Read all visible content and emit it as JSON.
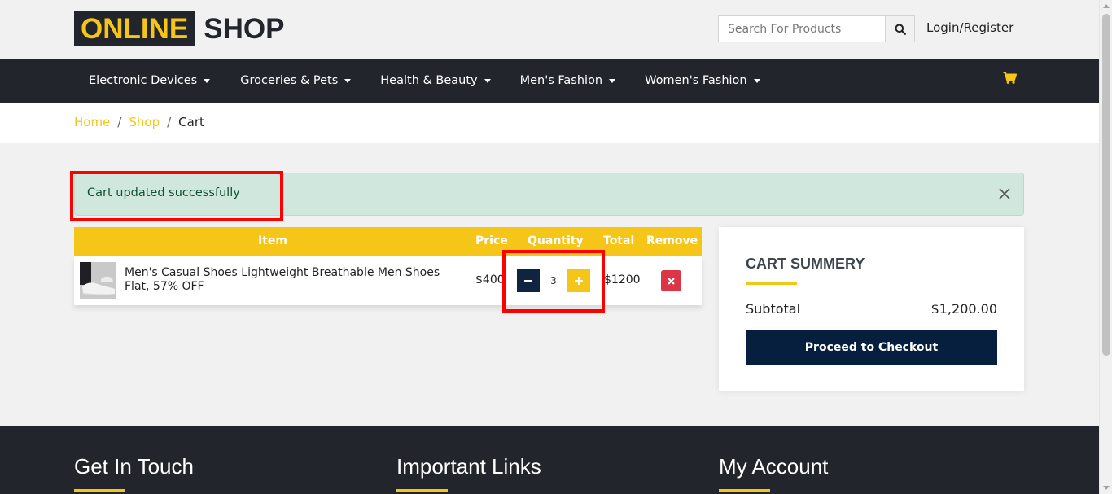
{
  "header": {
    "logo_highlight": "ONLINE",
    "logo_text": "SHOP",
    "search_placeholder": "Search For Products",
    "login_label": "Login/Register"
  },
  "nav": {
    "items": [
      {
        "label": "Electronic Devices"
      },
      {
        "label": "Groceries & Pets"
      },
      {
        "label": "Health & Beauty"
      },
      {
        "label": "Men's Fashion"
      },
      {
        "label": "Women's Fashion"
      }
    ]
  },
  "breadcrumb": {
    "home": "Home",
    "shop": "Shop",
    "current": "Cart",
    "separator": "/"
  },
  "alert": {
    "message": "Cart updated successfully"
  },
  "cart": {
    "columns": {
      "item": "Item",
      "price": "Price",
      "quantity": "Quantity",
      "total": "Total",
      "remove": "Remove"
    },
    "rows": [
      {
        "name": "Men's Casual Shoes Lightweight Breathable Men Shoes Flat, 57% OFF",
        "price": "$400",
        "quantity": "3",
        "total": "$1200"
      }
    ]
  },
  "summary": {
    "title": "CART SUMMERY",
    "subtotal_label": "Subtotal",
    "subtotal_value": "$1,200.00",
    "checkout_label": "Proceed to Checkout"
  },
  "footer": {
    "col1": "Get In Touch",
    "col2": "Important Links",
    "col3": "My Account"
  },
  "colors": {
    "accent": "#f5c518",
    "dark": "#23252d",
    "navy": "#061f3e",
    "danger": "#dc3545",
    "alert_bg": "#d0e7dd",
    "highlight": "#ff0000"
  },
  "icons": {
    "search": "search-icon",
    "cart": "cart-icon",
    "close": "close-icon",
    "minus": "minus-icon",
    "plus": "plus-icon",
    "remove": "times-icon"
  }
}
